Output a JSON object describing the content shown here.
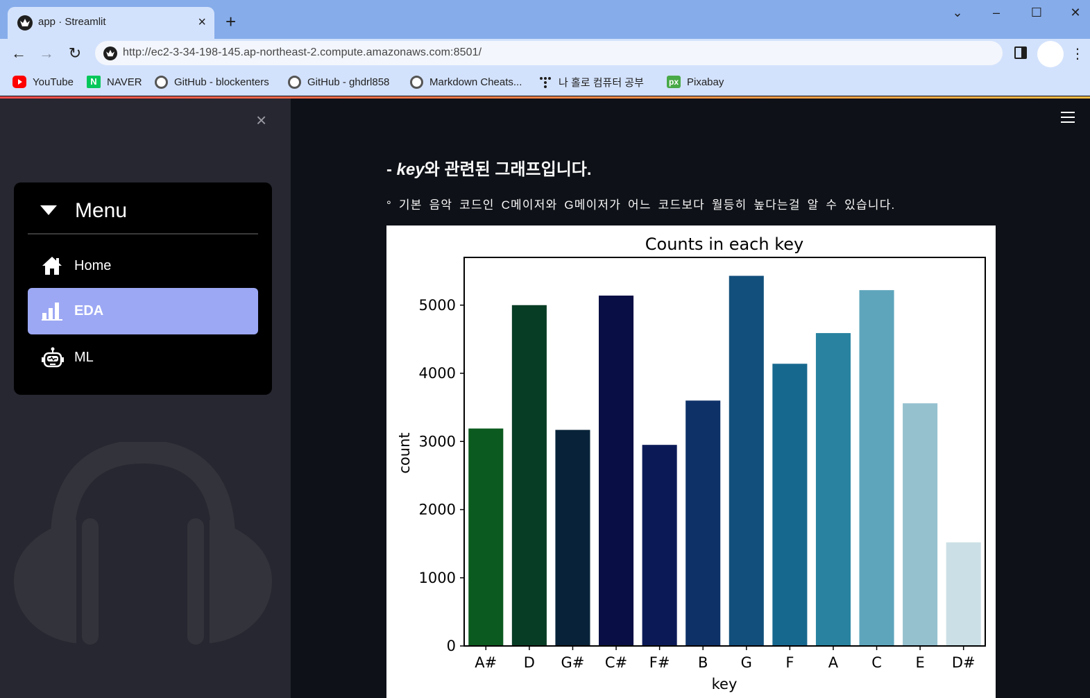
{
  "browser": {
    "tab_title": "app · Streamlit",
    "tab_close": "×",
    "new_tab": "+",
    "url": "http://ec2-3-34-198-145.ap-northeast-2.compute.amazonaws.com:8501/",
    "window_controls": {
      "collapse": "⌄",
      "minimize": "–",
      "maximize": "☐",
      "close": "✕"
    },
    "nav": {
      "back": "←",
      "forward": "→",
      "reload": "↻"
    }
  },
  "bookmarks": [
    {
      "label": "YouTube",
      "icon": "youtube-icon"
    },
    {
      "label": "NAVER",
      "icon": "naver-icon"
    },
    {
      "label": "GitHub - blockenters",
      "icon": "github-icon"
    },
    {
      "label": "GitHub - ghdrl858",
      "icon": "github-icon"
    },
    {
      "label": "Markdown Cheats...",
      "icon": "github-icon"
    },
    {
      "label": "나 홀로 컴퓨터 공부",
      "icon": "dots-icon"
    },
    {
      "label": "Pixabay",
      "icon": "pixabay-icon"
    }
  ],
  "sidebar": {
    "close": "×",
    "menu_title": "Menu",
    "items": [
      {
        "label": "Home",
        "icon": "home-icon",
        "active": false
      },
      {
        "label": "EDA",
        "icon": "bar-chart-icon",
        "active": true
      },
      {
        "label": "ML",
        "icon": "robot-icon",
        "active": false
      }
    ],
    "accent_color": "#9ca8f4"
  },
  "main": {
    "heading_prefix": "- ",
    "heading_key": "key",
    "heading_rest": "와 관련된 그래프입니다.",
    "description": "° 기본 음악 코드인 C메이저와 G메이저가 어느 코드보다 월등히 높다는걸 알 수 있습니다."
  },
  "chart_data": {
    "type": "bar",
    "title": "Counts in each key",
    "xlabel": "key",
    "ylabel": "count",
    "categories": [
      "A#",
      "D",
      "G#",
      "C#",
      "F#",
      "B",
      "G",
      "F",
      "A",
      "C",
      "E",
      "D#"
    ],
    "values": [
      3190,
      5000,
      3170,
      5140,
      2950,
      3600,
      5430,
      4140,
      4590,
      5220,
      3560,
      1520
    ],
    "colors": [
      "#0b5a1f",
      "#083d25",
      "#082339",
      "#090e44",
      "#0b1a57",
      "#0e3268",
      "#124f7c",
      "#17688f",
      "#2983a0",
      "#5ea5bc",
      "#95c1cf",
      "#cbe0e6"
    ],
    "ylim": [
      0,
      5700
    ],
    "yticks": [
      0,
      1000,
      2000,
      3000,
      4000,
      5000
    ],
    "grid": false
  }
}
